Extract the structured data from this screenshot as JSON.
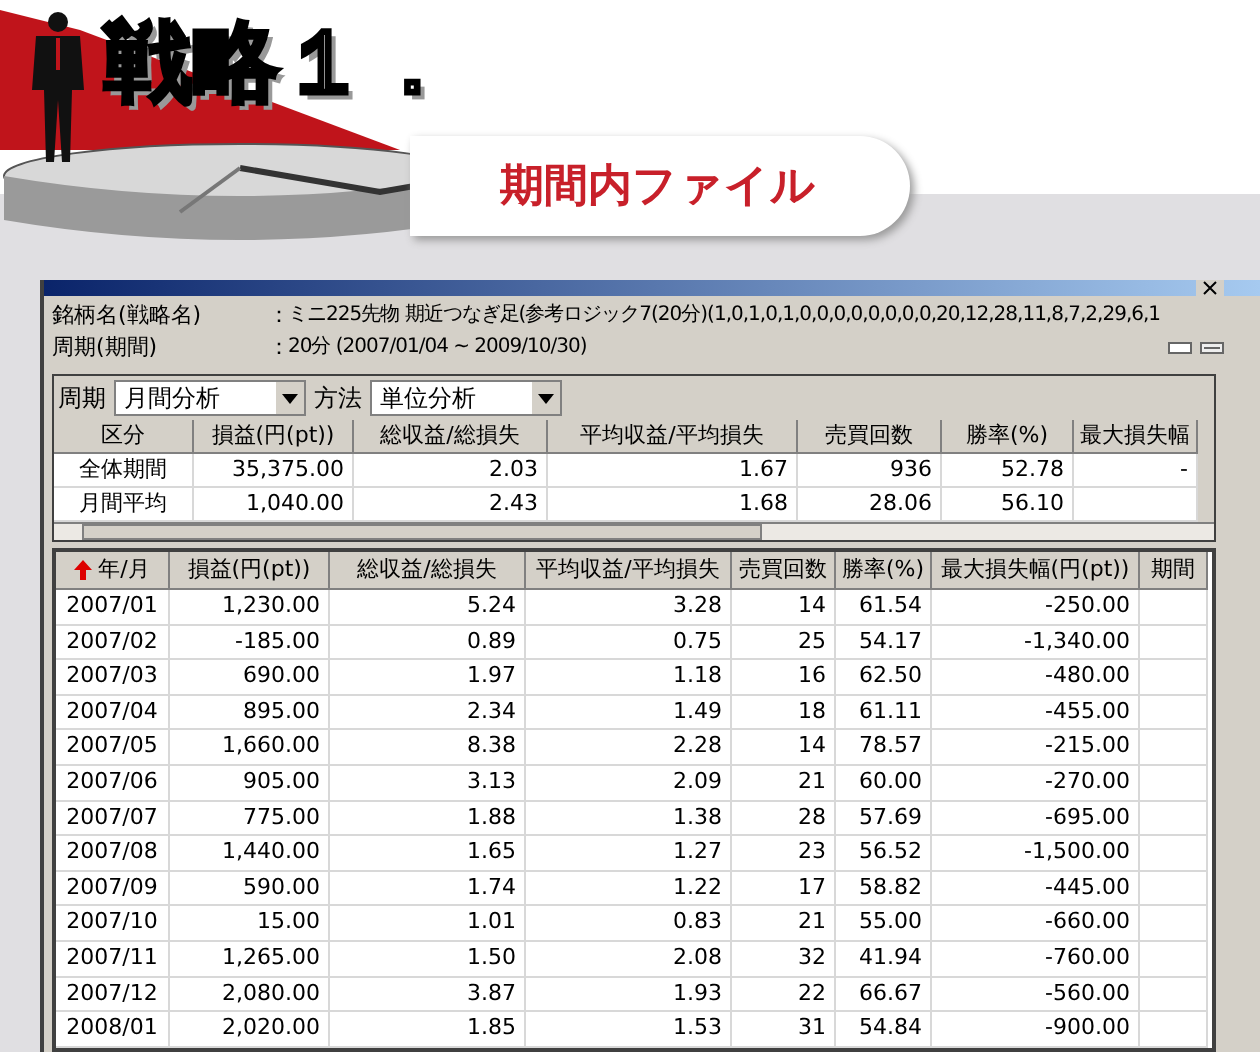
{
  "banner": {
    "title": "戦略１．",
    "subtitle": "期間内ファイル"
  },
  "info": [
    {
      "label": "銘柄名(戦略名)",
      "separator": "：",
      "value": "ミニ225先物 期近つなぎ足(参考ロジック7(20分)(1,0,1,0,1,0,0,0,0,0,0,0,0,20,12,28,11,8,7,2,29,6,1"
    },
    {
      "label": "周期(期間)",
      "separator": "：",
      "value": "20分 (2007/01/04 ~ 2009/10/30)"
    }
  ],
  "filters": [
    {
      "label": "周期",
      "value": "月間分析"
    },
    {
      "label": "方法",
      "value": "単位分析"
    }
  ],
  "summary": {
    "columns": [
      "区分",
      "損益(円(pt))",
      "総収益/総損失",
      "平均収益/平均損失",
      "売買回数",
      "勝率(%)",
      "最大損失幅"
    ],
    "rows": [
      [
        "全体期間",
        "35,375.00",
        "2.03",
        "1.67",
        "936",
        "52.78",
        "-"
      ],
      [
        "月間平均",
        "1,040.00",
        "2.43",
        "1.68",
        "28.06",
        "56.10",
        ""
      ]
    ]
  },
  "monthly": {
    "columns": [
      {
        "label": "年/月",
        "sorted": true
      },
      {
        "label": "損益(円(pt))",
        "sorted": false
      },
      {
        "label": "総収益/総損失",
        "sorted": false
      },
      {
        "label": "平均収益/平均損失",
        "sorted": false
      },
      {
        "label": "売買回数",
        "sorted": false
      },
      {
        "label": "勝率(%)",
        "sorted": false
      },
      {
        "label": "最大損失幅(円(pt))",
        "sorted": false
      },
      {
        "label": "期間",
        "sorted": false
      }
    ],
    "rows": [
      [
        "2007/01",
        "1,230.00",
        "5.24",
        "3.28",
        "14",
        "61.54",
        "-250.00"
      ],
      [
        "2007/02",
        "-185.00",
        "0.89",
        "0.75",
        "25",
        "54.17",
        "-1,340.00"
      ],
      [
        "2007/03",
        "690.00",
        "1.97",
        "1.18",
        "16",
        "62.50",
        "-480.00"
      ],
      [
        "2007/04",
        "895.00",
        "2.34",
        "1.49",
        "18",
        "61.11",
        "-455.00"
      ],
      [
        "2007/05",
        "1,660.00",
        "8.38",
        "2.28",
        "14",
        "78.57",
        "-215.00"
      ],
      [
        "2007/06",
        "905.00",
        "3.13",
        "2.09",
        "21",
        "60.00",
        "-270.00"
      ],
      [
        "2007/07",
        "775.00",
        "1.88",
        "1.38",
        "28",
        "57.69",
        "-695.00"
      ],
      [
        "2007/08",
        "1,440.00",
        "1.65",
        "1.27",
        "23",
        "56.52",
        "-1,500.00"
      ],
      [
        "2007/09",
        "590.00",
        "1.74",
        "1.22",
        "17",
        "58.82",
        "-445.00"
      ],
      [
        "2007/10",
        "15.00",
        "1.01",
        "0.83",
        "21",
        "55.00",
        "-660.00"
      ],
      [
        "2007/11",
        "1,265.00",
        "1.50",
        "2.08",
        "32",
        "41.94",
        "-760.00"
      ],
      [
        "2007/12",
        "2,080.00",
        "3.87",
        "1.93",
        "22",
        "66.67",
        "-560.00"
      ],
      [
        "2008/01",
        "2,020.00",
        "1.85",
        "1.53",
        "31",
        "54.84",
        "-900.00"
      ]
    ]
  }
}
